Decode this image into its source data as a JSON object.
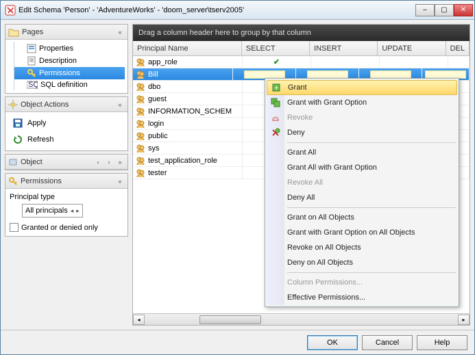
{
  "window": {
    "title": "Edit Schema 'Person' - 'AdventureWorks' - 'doom_server\\tserv2005'"
  },
  "pages": {
    "header": "Pages",
    "items": [
      "Properties",
      "Description",
      "Permissions",
      "SQL definition"
    ],
    "selected_index": 2
  },
  "object_actions": {
    "header": "Object Actions",
    "apply": "Apply",
    "refresh": "Refresh"
  },
  "object_panel": {
    "header": "Object"
  },
  "permissions_panel": {
    "header": "Permissions",
    "principal_type_label": "Principal type",
    "principal_type_value": "All principals",
    "granted_only_label": "Granted or denied only",
    "granted_only_checked": false
  },
  "grid": {
    "group_hint": "Drag a column header here to group by that column",
    "columns": [
      "Principal Name",
      "SELECT",
      "INSERT",
      "UPDATE",
      "DEL"
    ],
    "rows": [
      {
        "name": "app_role",
        "select_tick": true
      },
      {
        "name": "Bill",
        "selected": true,
        "highlight_cells": true
      },
      {
        "name": "dbo",
        "select_tick": true
      },
      {
        "name": "guest"
      },
      {
        "name": "INFORMATION_SCHEM"
      },
      {
        "name": "login"
      },
      {
        "name": "public"
      },
      {
        "name": "sys"
      },
      {
        "name": "test_application_role",
        "select_tick": true
      },
      {
        "name": "tester",
        "select_tick": true
      }
    ]
  },
  "context_menu": {
    "items": [
      {
        "label": "Grant",
        "icon": "grant-icon",
        "highlight": true
      },
      {
        "label": "Grant with Grant Option",
        "icon": "grant-opt-icon"
      },
      {
        "label": "Revoke",
        "icon": "revoke-icon",
        "disabled": true
      },
      {
        "label": "Deny",
        "icon": "deny-icon"
      },
      {
        "sep": true
      },
      {
        "label": "Grant All"
      },
      {
        "label": "Grant All with Grant Option"
      },
      {
        "label": "Revoke All",
        "disabled": true
      },
      {
        "label": "Deny All"
      },
      {
        "sep": true
      },
      {
        "label": "Grant on All Objects"
      },
      {
        "label": "Grant with Grant Option on All Objects"
      },
      {
        "label": "Revoke on All Objects"
      },
      {
        "label": "Deny on All Objects"
      },
      {
        "sep": true
      },
      {
        "label": "Column Permissions...",
        "disabled": true
      },
      {
        "label": "Effective Permissions..."
      }
    ]
  },
  "footer": {
    "ok": "OK",
    "cancel": "Cancel",
    "help": "Help"
  }
}
